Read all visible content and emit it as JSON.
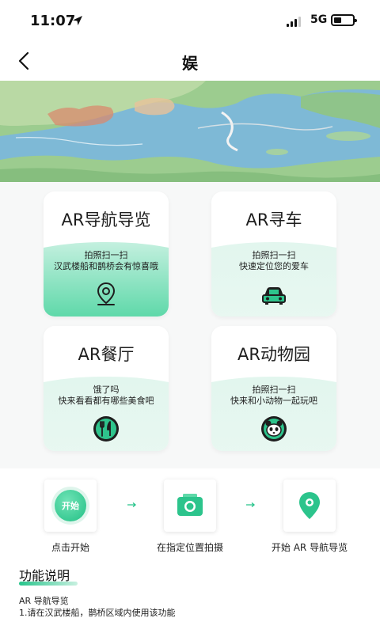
{
  "status_bar": {
    "time": "11:07",
    "network": "5G"
  },
  "nav": {
    "title": "娱"
  },
  "cards": [
    {
      "title": "AR导航导览",
      "line1": "拍照扫一扫",
      "line2": "汉武楼船和鹊桥会有惊喜哦",
      "icon": "location-pin-icon"
    },
    {
      "title": "AR寻车",
      "line1": "拍照扫一扫",
      "line2": "快速定位您的爱车",
      "icon": "car-icon"
    },
    {
      "title": "AR餐厅",
      "line1": "饿了吗",
      "line2": "快来看看都有哪些美食吧",
      "icon": "cutlery-icon"
    },
    {
      "title": "AR动物园",
      "line1": "拍照扫一扫",
      "line2": "快来和小动物一起玩吧",
      "icon": "panda-icon"
    }
  ],
  "steps": [
    {
      "label": "点击开始",
      "button": "开始"
    },
    {
      "label": "在指定位置拍摄"
    },
    {
      "label": "开始 AR 导航导览"
    }
  ],
  "func": {
    "title": "功能说明",
    "line1": "AR 导航导览",
    "line2": "1.请在汉武楼船，鹊桥区域内使用该功能"
  },
  "colors": {
    "accent": "#27c48b",
    "card_bg": "#f7f8f8",
    "water": "#7ab8d8",
    "land": "#8fc48a"
  }
}
